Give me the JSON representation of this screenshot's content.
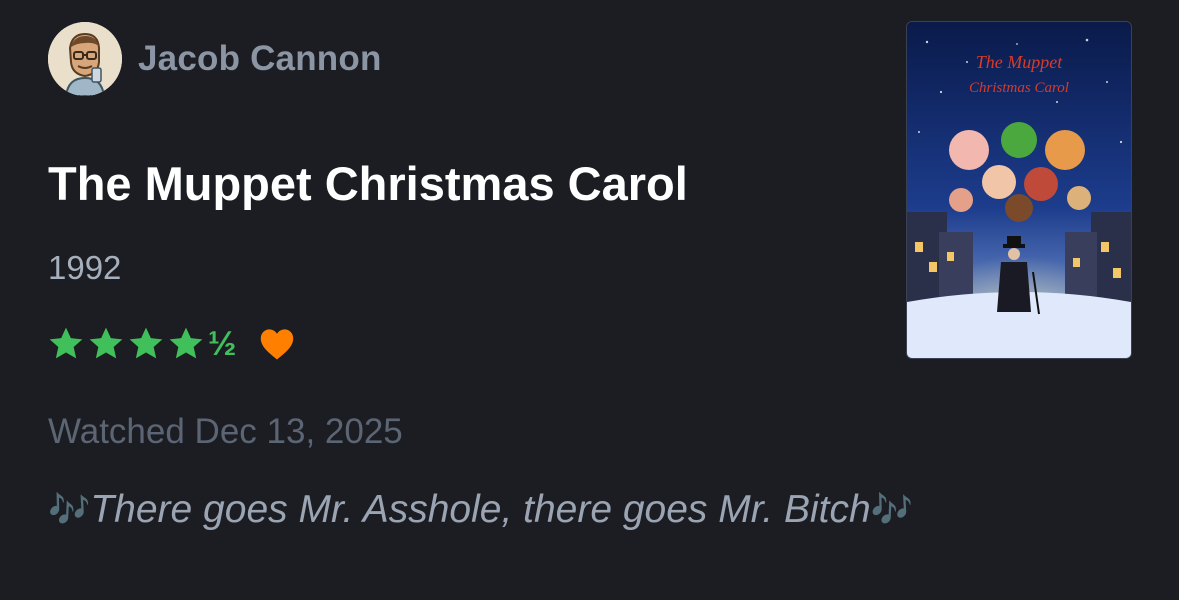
{
  "user": {
    "name": "Jacob Cannon",
    "avatar": "user-avatar-illustration"
  },
  "film": {
    "title": "The Muppet Christmas Carol",
    "year": "1992",
    "poster_title_line1": "The Muppet",
    "poster_title_line2": "Christmas Carol"
  },
  "rating": {
    "stars": 4.5,
    "full_star_glyph": "★",
    "half_label": "½",
    "liked": true,
    "star_color": "#40bf5b",
    "heart_color": "#ff8000"
  },
  "watched": {
    "label": "Watched Dec 13, 2025"
  },
  "review": {
    "prefix_icon": "🎶",
    "text": "There goes Mr. Asshole, there goes Mr. Bitch",
    "suffix_icon": "🎶"
  },
  "colors": {
    "background": "#1b1d23",
    "username": "#8b95a3",
    "title": "#ffffff",
    "meta": "#5c6573",
    "review": "#9aa4b2"
  }
}
